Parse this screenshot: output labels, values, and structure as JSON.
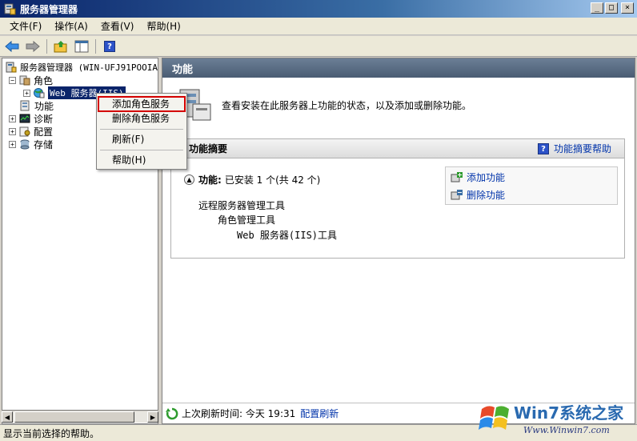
{
  "window": {
    "title": "服务器管理器",
    "minimize": "_",
    "maximize": "□",
    "close": "×"
  },
  "menu": {
    "items": [
      "文件(F)",
      "操作(A)",
      "查看(V)",
      "帮助(H)"
    ]
  },
  "toolbar": {
    "icons": [
      "back-arrow-icon",
      "forward-arrow-icon",
      "up-folder-icon",
      "show-hide-tree-icon",
      "help-icon"
    ]
  },
  "tree": {
    "root": "服务器管理器 (WIN-UFJ91POOIA",
    "roles": "角色",
    "iis": "Web 服务器(IIS)",
    "features": "功能",
    "diagnostics": "诊断",
    "config": "配置",
    "storage": "存储",
    "expand": "+",
    "collapse": "−"
  },
  "context_menu": {
    "items": [
      "添加角色服务",
      "删除角色服务",
      "刷新(F)",
      "帮助(H)"
    ]
  },
  "right": {
    "header": "功能",
    "intro": "查看安装在此服务器上功能的状态，以及添加或删除功能。",
    "summary_title": "功能摘要",
    "summary_help": "功能摘要帮助",
    "features_label": "功能:",
    "features_status": "已安装 1 个(共 42 个)",
    "feature_tree": [
      "远程服务器管理工具",
      "角色管理工具",
      "Web 服务器(IIS)工具"
    ],
    "add_feature": "添加功能",
    "remove_feature": "删除功能",
    "footer_label": "上次刷新时间: 今天 19:31",
    "footer_link": "配置刷新"
  },
  "statusbar": {
    "text": "显示当前选择的帮助。"
  },
  "watermark": {
    "brand": "Win7系统之家",
    "url": "Www.Winwin7.com"
  }
}
